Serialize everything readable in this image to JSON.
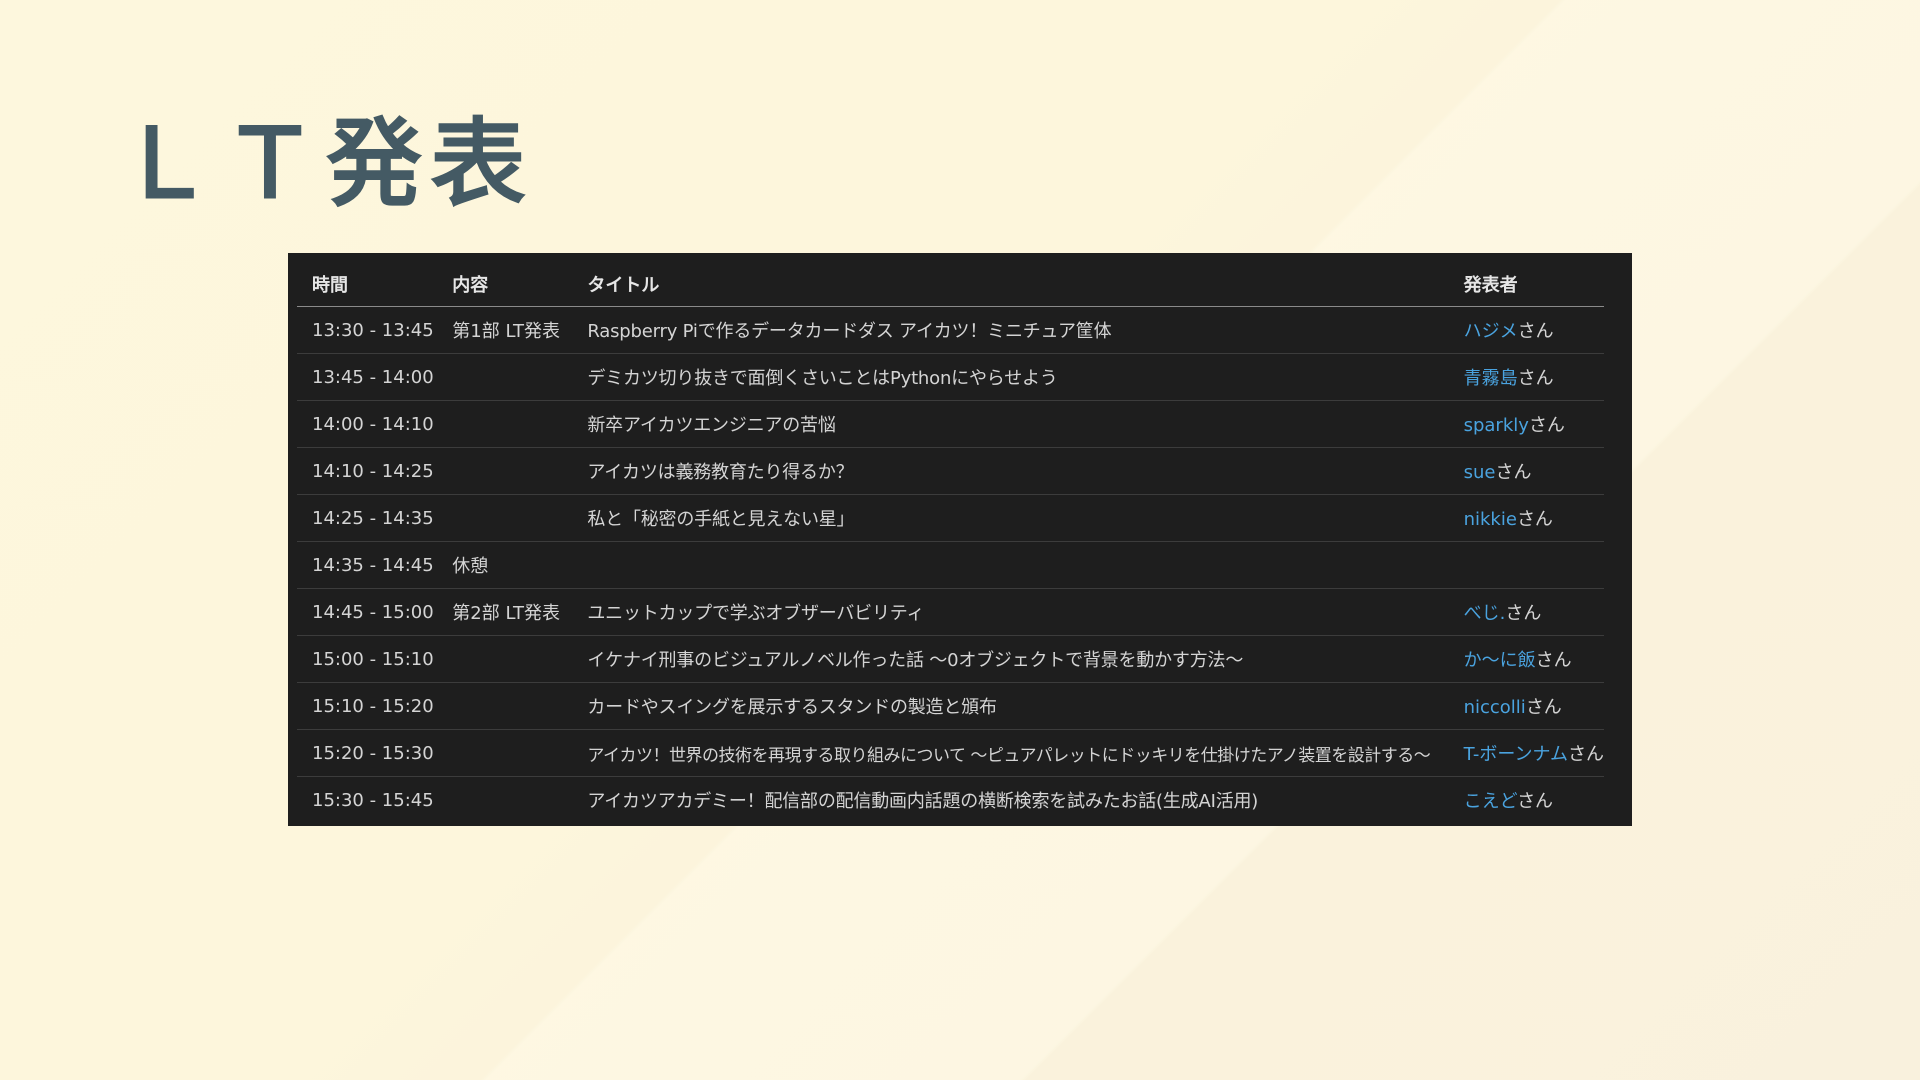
{
  "slide": {
    "title": "ＬＴ発表"
  },
  "table": {
    "headers": {
      "time": "時間",
      "content": "内容",
      "title": "タイトル",
      "presenter": "発表者"
    },
    "honorific": "さん",
    "rows": [
      {
        "time": "13:30 - 13:45",
        "content": "第1部 LT発表",
        "title": "Raspberry Piで作るデータカードダス アイカツ！ミニチュア筐体",
        "presenter": "ハジメ",
        "suffix": "さん"
      },
      {
        "time": "13:45 - 14:00",
        "content": "",
        "title": "デミカツ切り抜きで面倒くさいことはPythonにやらせよう",
        "presenter": "青霧島",
        "suffix": "さん"
      },
      {
        "time": "14:00 - 14:10",
        "content": "",
        "title": "新卒アイカツエンジニアの苦悩",
        "presenter": "sparkly",
        "suffix": "さん"
      },
      {
        "time": "14:10 - 14:25",
        "content": "",
        "title": "アイカツは義務教育たり得るか？",
        "presenter": "sue",
        "suffix": "さん"
      },
      {
        "time": "14:25 - 14:35",
        "content": "",
        "title": "私と「秘密の手紙と見えない星」",
        "presenter": "nikkie",
        "suffix": "さん"
      },
      {
        "time": "14:35 - 14:45",
        "content": "休憩",
        "title": "",
        "presenter": "",
        "suffix": ""
      },
      {
        "time": "14:45 - 15:00",
        "content": "第2部 LT発表",
        "title": "ユニットカップで学ぶオブザーバビリティ",
        "presenter": "べじ.",
        "suffix": "さん"
      },
      {
        "time": "15:00 - 15:10",
        "content": "",
        "title": "イケナイ刑事のビジュアルノベル作った話 ～0オブジェクトで背景を動かす方法～",
        "presenter": "か～に飯",
        "suffix": "さん"
      },
      {
        "time": "15:10 - 15:20",
        "content": "",
        "title": "カードやスイングを展示するスタンドの製造と頒布",
        "presenter": "niccolli",
        "suffix": "さん"
      },
      {
        "time": "15:20 - 15:30",
        "content": "",
        "title": "アイカツ！世界の技術を再現する取り組みについて ～ピュアパレットにドッキリを仕掛けたアノ装置を設計する～",
        "presenter": "T-ボーンナム",
        "suffix": "さん"
      },
      {
        "time": "15:30 - 15:45",
        "content": "",
        "title": "アイカツアカデミー！配信部の配信動画内話題の横断検索を試みたお話(生成AI活用)",
        "presenter": "こえど",
        "suffix": "さん"
      }
    ]
  },
  "colors": {
    "title": "#445a64",
    "panel_bg": "#1e1e1e",
    "link": "#4aa3df",
    "text": "#d4d4d4"
  }
}
